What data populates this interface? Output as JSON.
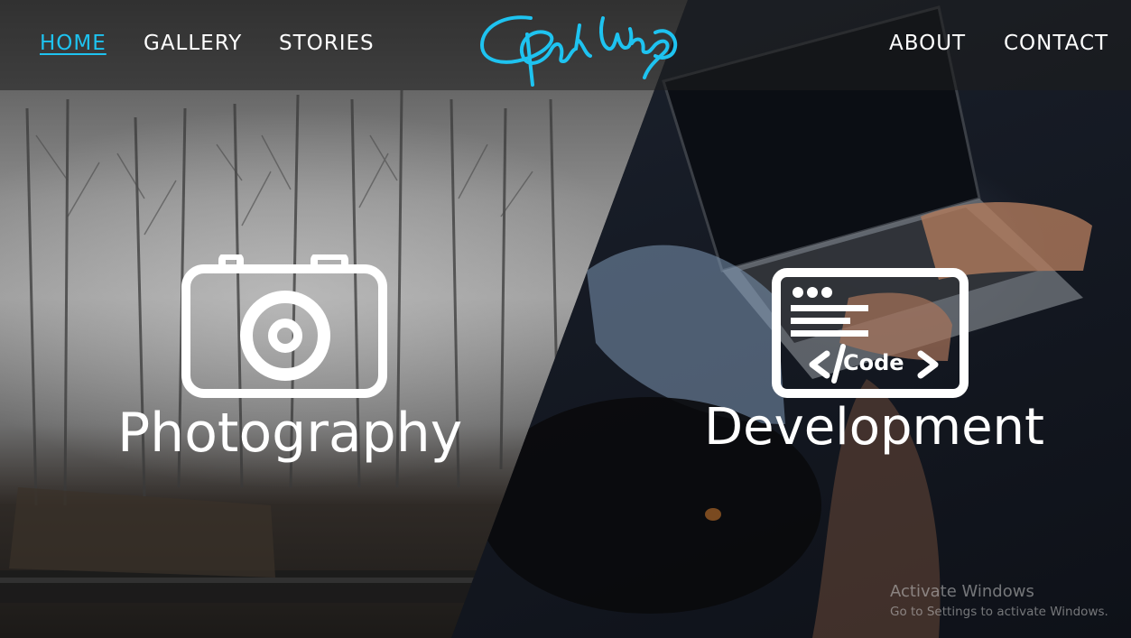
{
  "nav": {
    "left": [
      {
        "label": "HOME",
        "active": true
      },
      {
        "label": "GALLERY",
        "active": false
      },
      {
        "label": "STORIES",
        "active": false
      }
    ],
    "right": [
      {
        "label": "ABOUT",
        "active": false
      },
      {
        "label": "CONTACT",
        "active": false
      }
    ]
  },
  "logo": {
    "icon": "signature-logo",
    "color": "#1ec3f0"
  },
  "features": {
    "photography": {
      "label": "Photography",
      "icon": "camera-icon"
    },
    "development": {
      "label": "Development",
      "icon": "code-window-icon",
      "icon_text": "</Code"
    }
  },
  "watermark": {
    "title": "Activate Windows",
    "subtitle": "Go to Settings to activate Windows."
  },
  "colors": {
    "accent": "#1ec3f0",
    "nav_text": "#ffffff",
    "header_bg": "rgba(30,30,30,0.55)"
  }
}
